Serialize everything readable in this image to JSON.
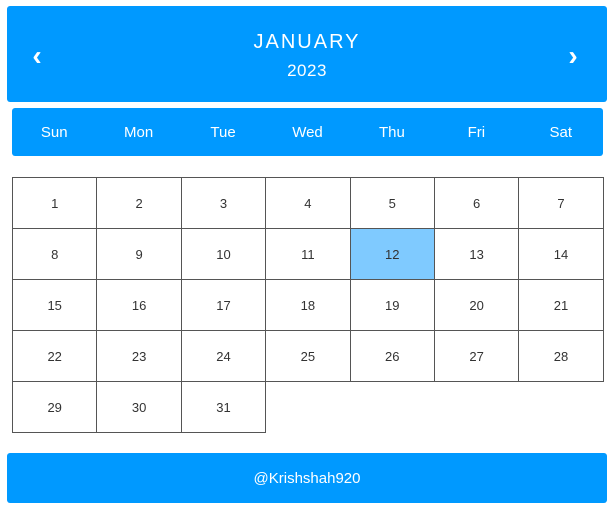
{
  "header": {
    "prev_icon": "‹",
    "next_icon": "›",
    "month": "JANUARY",
    "year": "2023"
  },
  "weekdays": [
    "Sun",
    "Mon",
    "Tue",
    "Wed",
    "Thu",
    "Fri",
    "Sat"
  ],
  "days": [
    "1",
    "2",
    "3",
    "4",
    "5",
    "6",
    "7",
    "8",
    "9",
    "10",
    "11",
    "12",
    "13",
    "14",
    "15",
    "16",
    "17",
    "18",
    "19",
    "20",
    "21",
    "22",
    "23",
    "24",
    "25",
    "26",
    "27",
    "28",
    "29",
    "30",
    "31"
  ],
  "highlighted_day": "12",
  "footer": {
    "credit": "@Krishshah920"
  },
  "colors": {
    "accent": "#0099ff",
    "highlight": "#7fcaff"
  }
}
